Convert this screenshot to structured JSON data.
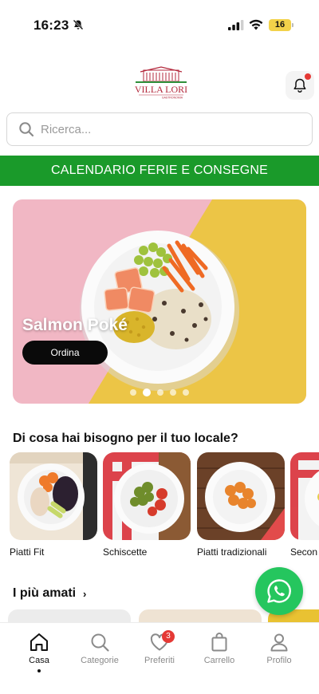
{
  "status_bar": {
    "time": "16:23",
    "battery": "16"
  },
  "header": {
    "logo_text": "VILLA LORI",
    "logo_subtext": "GASTRONOMIA"
  },
  "search": {
    "placeholder": "Ricerca..."
  },
  "banner": {
    "text": "CALENDARIO FERIE E CONSEGNE",
    "color": "#1a9a2a"
  },
  "hero": {
    "title": "Salmon Poké",
    "button_label": "Ordina",
    "slide_count": 5,
    "active_slide": 2,
    "colors": {
      "pink": "#f1b7c4",
      "yellow": "#ecc546"
    }
  },
  "categories_section": {
    "title": "Di cosa hai bisogno per il tuo locale?",
    "items": [
      {
        "label": "Piatti Fit"
      },
      {
        "label": "Schiscette"
      },
      {
        "label": "Piatti tradizionali"
      },
      {
        "label": "Secon"
      }
    ]
  },
  "loved_section": {
    "title": "I più amati",
    "chevron": "›"
  },
  "bottom_nav": {
    "items": [
      {
        "label": "Casa",
        "icon": "home-icon",
        "active": true
      },
      {
        "label": "Categorie",
        "icon": "search-icon",
        "active": false
      },
      {
        "label": "Preferiti",
        "icon": "heart-icon",
        "active": false,
        "badge": "3"
      },
      {
        "label": "Carrello",
        "icon": "bag-icon",
        "active": false
      },
      {
        "label": "Profilo",
        "icon": "user-icon",
        "active": false
      }
    ]
  },
  "accent": {
    "green": "#1a9a2a",
    "whatsapp": "#25c65e",
    "badge": "#e53935"
  }
}
